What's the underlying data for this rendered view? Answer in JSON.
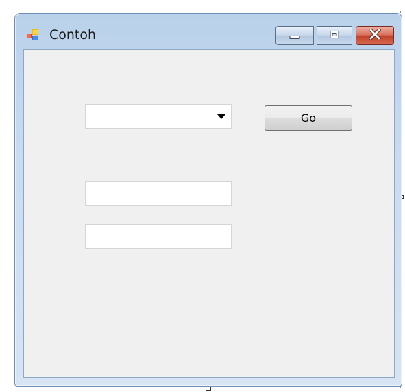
{
  "window": {
    "title": "Contoh",
    "icon": "form-icon"
  },
  "caption_buttons": {
    "minimize_icon": "minimize-icon",
    "maximize_icon": "maximize-icon",
    "close_icon": "close-icon"
  },
  "form": {
    "combo_value": "",
    "go_label": "Go",
    "textbox1_value": "",
    "textbox2_value": ""
  },
  "colors": {
    "client_bg": "#f0f0f0",
    "close_button": "#c2432c"
  }
}
